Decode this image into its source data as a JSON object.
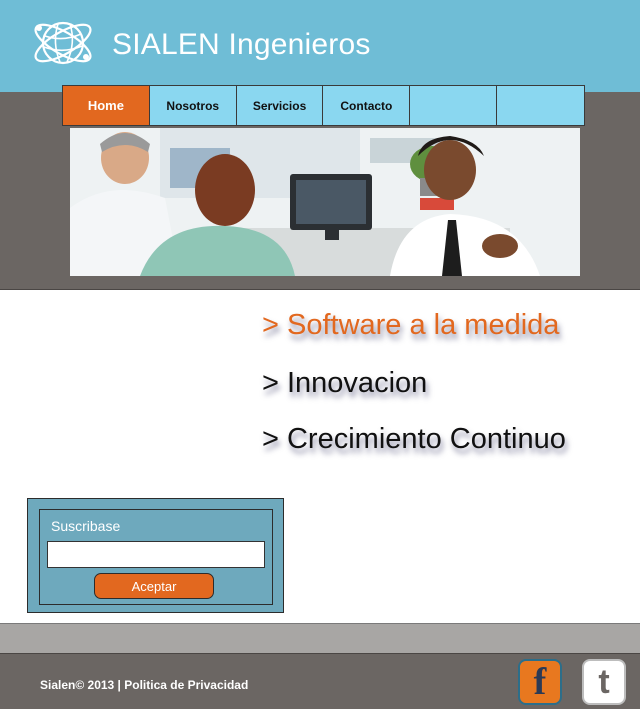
{
  "header": {
    "title": "SIALEN Ingenieros",
    "logo_icon": "atom-globe-logo-icon"
  },
  "nav": {
    "items": [
      {
        "label": "Home",
        "active": true
      },
      {
        "label": "Nosotros",
        "active": false
      },
      {
        "label": "Servicios",
        "active": false
      },
      {
        "label": "Contacto",
        "active": false
      },
      {
        "label": "",
        "active": false
      },
      {
        "label": "",
        "active": false
      }
    ]
  },
  "taglines": [
    "> Software a la medida",
    "> Innovacion",
    "> Crecimiento Continuo"
  ],
  "subscribe": {
    "label": "Suscribase",
    "input_value": "",
    "button_label": "Aceptar"
  },
  "footer": {
    "copyright": "Sialen© 2013 | Politica de Privacidad",
    "social": [
      {
        "name": "facebook-icon",
        "glyph": "f"
      },
      {
        "name": "twitter-icon",
        "glyph": "t"
      }
    ]
  },
  "colors": {
    "header_bg": "#6fbdd6",
    "band_bg": "#6b6663",
    "nav_bg": "#8ad7f0",
    "accent_orange": "#e2681f",
    "subscribe_bg": "#6ea9bd"
  }
}
